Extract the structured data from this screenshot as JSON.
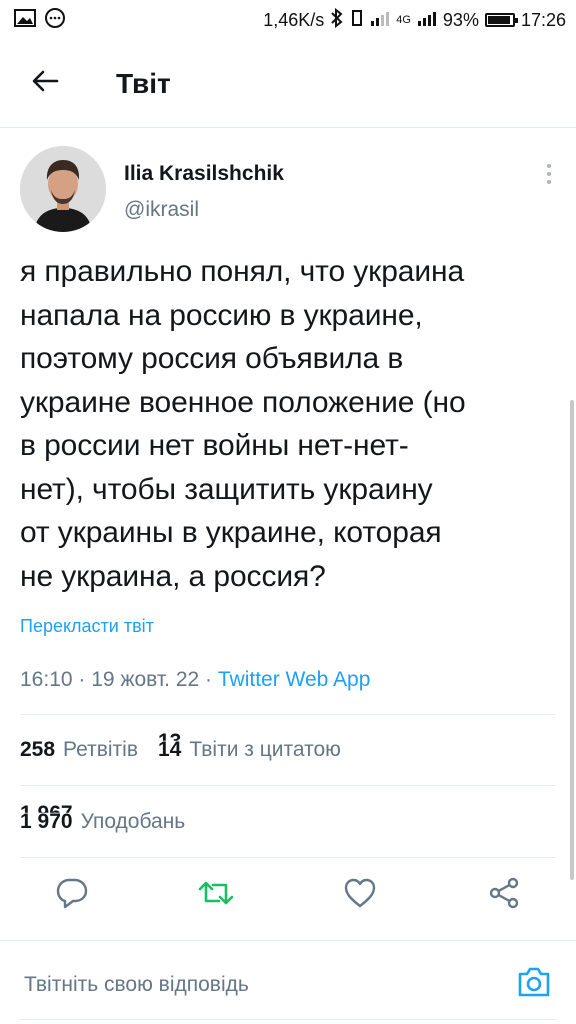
{
  "status_bar": {
    "left_icons": [
      "gallery-icon",
      "chat-icon"
    ],
    "speed": "1,46K/s",
    "battery": "93%",
    "battery_level": 0.93,
    "network": "4G",
    "time": "17:26"
  },
  "header": {
    "title": "Твіт"
  },
  "author": {
    "name": "Ilia Krasilshchik",
    "handle": "@ikrasil"
  },
  "tweet": {
    "lines": [
      "я правильно понял, что украина",
      "напала на россию в украине,",
      "поэтому россия объявила в",
      "украине военное положение (но",
      "в россии нет войны нет-нет-",
      "нет), чтобы защитить украину",
      "от украины в украине, которая",
      "не украина, а россия?"
    ],
    "translate_label": "Перекласти твіт",
    "time": "16:10",
    "date": "19 жовт. 22",
    "source": "Twitter Web App",
    "separator": "·"
  },
  "stats": {
    "retweets_count": "258",
    "retweets_label": "Ретвітів",
    "quotes_count": "14",
    "quotes_count_overlay": "13",
    "quotes_label": "Твіти з цитатою",
    "likes_count": "1 970",
    "likes_count_overlay": "1 967",
    "likes_label": "Уподобань"
  },
  "actions": {
    "icons": [
      "reply-icon",
      "retweet-icon",
      "like-icon",
      "share-icon"
    ],
    "retweet_color": "#17bf63"
  },
  "reply": {
    "placeholder": "Твітніть свою відповідь"
  },
  "colors": {
    "accent": "#1da1f2",
    "text": "#14171a",
    "secondary": "#657786",
    "divider": "#e6ecf0"
  }
}
